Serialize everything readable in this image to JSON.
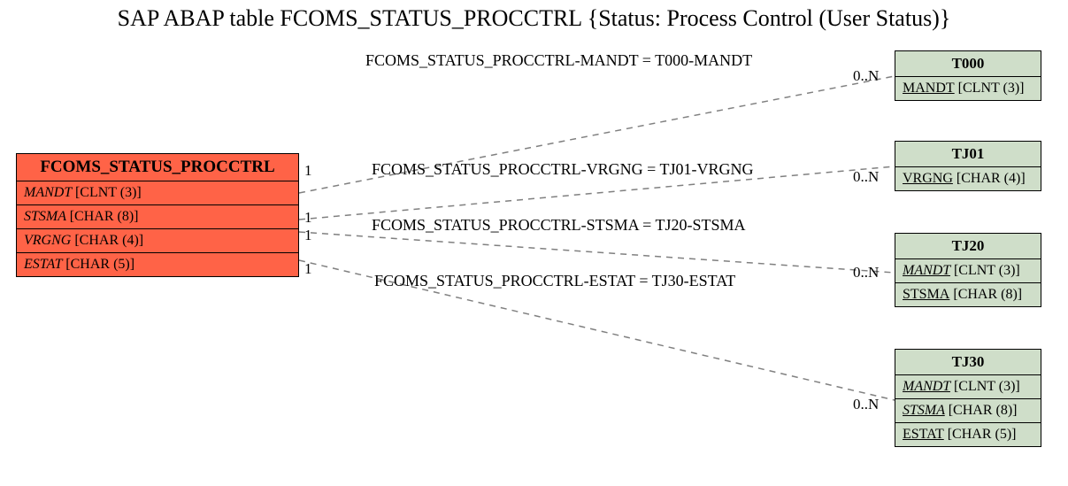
{
  "title": "SAP ABAP table FCOMS_STATUS_PROCCTRL {Status: Process Control (User Status)}",
  "main_entity": {
    "name": "FCOMS_STATUS_PROCCTRL",
    "fields": [
      {
        "name": "MANDT",
        "type": "[CLNT (3)]"
      },
      {
        "name": "STSMA",
        "type": "[CHAR (8)]"
      },
      {
        "name": "VRGNG",
        "type": "[CHAR (4)]"
      },
      {
        "name": "ESTAT",
        "type": "[CHAR (5)]"
      }
    ]
  },
  "ref_entities": {
    "t000": {
      "name": "T000",
      "fields": [
        {
          "name": "MANDT",
          "type": "[CLNT (3)]",
          "underline": true
        }
      ]
    },
    "tj01": {
      "name": "TJ01",
      "fields": [
        {
          "name": "VRGNG",
          "type": "[CHAR (4)]",
          "underline": true
        }
      ]
    },
    "tj20": {
      "name": "TJ20",
      "fields": [
        {
          "name": "MANDT",
          "type": "[CLNT (3)]",
          "underline": true,
          "italic_name": true
        },
        {
          "name": "STSMA",
          "type": "[CHAR (8)]",
          "underline": true
        }
      ]
    },
    "tj30": {
      "name": "TJ30",
      "fields": [
        {
          "name": "MANDT",
          "type": "[CLNT (3)]",
          "underline": true,
          "italic_name": true
        },
        {
          "name": "STSMA",
          "type": "[CHAR (8)]",
          "underline": true,
          "italic_name": true
        },
        {
          "name": "ESTAT",
          "type": "[CHAR (5)]",
          "underline": true
        }
      ]
    }
  },
  "relations": [
    {
      "label": "FCOMS_STATUS_PROCCTRL-MANDT = T000-MANDT",
      "left_card": "1",
      "right_card": "0..N"
    },
    {
      "label": "FCOMS_STATUS_PROCCTRL-VRGNG = TJ01-VRGNG",
      "left_card": "1",
      "right_card": "0..N"
    },
    {
      "label": "FCOMS_STATUS_PROCCTRL-STSMA = TJ20-STSMA",
      "left_card": "1",
      "right_card": "0..N"
    },
    {
      "label": "FCOMS_STATUS_PROCCTRL-ESTAT = TJ30-ESTAT",
      "left_card": "1",
      "right_card": "0..N"
    }
  ],
  "chart_data": {
    "type": "diagram",
    "description": "Entity-relationship diagram for SAP ABAP table FCOMS_STATUS_PROCCTRL",
    "main_table": "FCOMS_STATUS_PROCCTRL",
    "main_fields": [
      "MANDT CLNT(3)",
      "STSMA CHAR(8)",
      "VRGNG CHAR(4)",
      "ESTAT CHAR(5)"
    ],
    "foreign_keys": [
      {
        "join": "FCOMS_STATUS_PROCCTRL-MANDT = T000-MANDT",
        "cardinality": "1 to 0..N",
        "target": "T000",
        "target_fields": [
          "MANDT CLNT(3)"
        ]
      },
      {
        "join": "FCOMS_STATUS_PROCCTRL-VRGNG = TJ01-VRGNG",
        "cardinality": "1 to 0..N",
        "target": "TJ01",
        "target_fields": [
          "VRGNG CHAR(4)"
        ]
      },
      {
        "join": "FCOMS_STATUS_PROCCTRL-STSMA = TJ20-STSMA",
        "cardinality": "1 to 0..N",
        "target": "TJ20",
        "target_fields": [
          "MANDT CLNT(3)",
          "STSMA CHAR(8)"
        ]
      },
      {
        "join": "FCOMS_STATUS_PROCCTRL-ESTAT = TJ30-ESTAT",
        "cardinality": "1 to 0..N",
        "target": "TJ30",
        "target_fields": [
          "MANDT CLNT(3)",
          "STSMA CHAR(8)",
          "ESTAT CHAR(5)"
        ]
      }
    ]
  }
}
